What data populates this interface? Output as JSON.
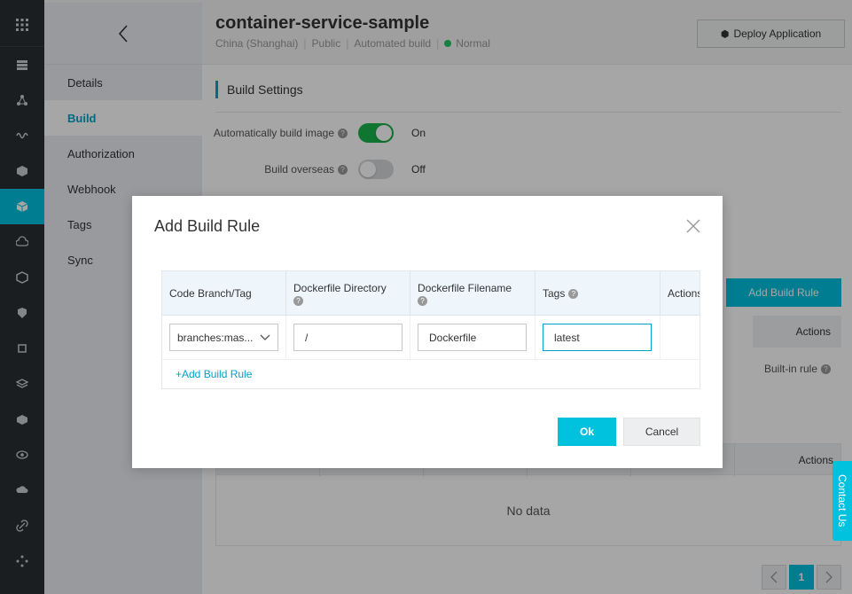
{
  "repo": {
    "title": "container-service-sample",
    "region": "China (Shanghai)",
    "visibility": "Public",
    "build_type": "Automated build",
    "status": "Normal",
    "deploy_label": "Deploy Application"
  },
  "subnav": {
    "items": [
      {
        "label": "Details"
      },
      {
        "label": "Build"
      },
      {
        "label": "Authorization"
      },
      {
        "label": "Webhook"
      },
      {
        "label": "Tags"
      },
      {
        "label": "Sync"
      }
    ],
    "active": "Build"
  },
  "build_settings": {
    "title": "Build Settings",
    "auto_build_label": "Automatically build image",
    "auto_build_value": "On",
    "overseas_label": "Build overseas",
    "overseas_value": "Off"
  },
  "background": {
    "add_rule_label": "Add Build Rule",
    "actions_label": "Actions",
    "builtin_rule": "Built-in rule",
    "actions2_label": "Actions",
    "no_data": "No data",
    "page": "1",
    "contact": "Contact Us"
  },
  "modal": {
    "title": "Add Build Rule",
    "columns": {
      "branch": "Code Branch/Tag",
      "dir": "Dockerfile Directory",
      "file": "Dockerfile Filename",
      "tags": "Tags",
      "actions": "Actions"
    },
    "row": {
      "branch": "branches:mas...",
      "dir": "/",
      "file": "Dockerfile",
      "tags": "latest"
    },
    "add_link": "+Add Build Rule",
    "ok": "Ok",
    "cancel": "Cancel"
  },
  "colors": {
    "accent": "#00c1de",
    "link": "#00a2ca",
    "on": "#1ab44a",
    "rail": "#2a2f33"
  }
}
